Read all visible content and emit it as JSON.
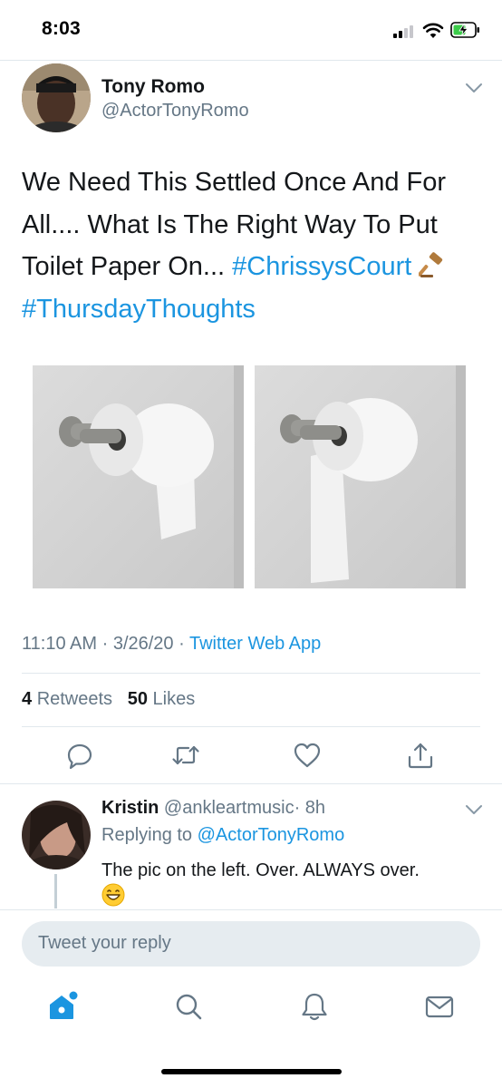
{
  "status_bar": {
    "time": "8:03",
    "icons": [
      "cellular-signal-icon",
      "wifi-icon",
      "battery-charging-icon"
    ]
  },
  "tweet": {
    "author_name": "Tony Romo",
    "author_handle": "@ActorTonyRomo",
    "text_plain": "We Need This Settled Once And For All.... What Is The Right Way To Put Toilet Paper On...",
    "hashtag_1": "#ChrissysCourt",
    "emoji": "gavel-icon",
    "hashtag_2": "#ThursdayThoughts",
    "media": [
      {
        "name": "toilet-paper-over-photo"
      },
      {
        "name": "toilet-paper-under-photo"
      }
    ],
    "time": "11:10 AM",
    "date": "3/26/20",
    "source": "Twitter Web App",
    "retweet_count": "4",
    "retweet_label": "Retweets",
    "like_count": "50",
    "like_label": "Likes",
    "actions": [
      "reply-icon",
      "retweet-icon",
      "like-icon",
      "share-icon"
    ]
  },
  "reply": {
    "author_name": "Kristin",
    "author_handle": "@ankleartmusic",
    "time": "· 8h",
    "replying_prefix": "Replying to",
    "replying_handle": "@ActorTonyRomo",
    "text": "The pic on the left. Over. ALWAYS over.",
    "emoji": "grinning-face-icon"
  },
  "compose": {
    "placeholder": "Tweet your reply"
  },
  "nav": [
    "home-icon",
    "search-icon",
    "notifications-icon",
    "messages-icon"
  ],
  "colors": {
    "accent": "#1b95e0",
    "text_primary": "#14171a",
    "text_secondary": "#657786",
    "divider": "#e1e8ed",
    "compose_bg": "#e6ecf0"
  }
}
